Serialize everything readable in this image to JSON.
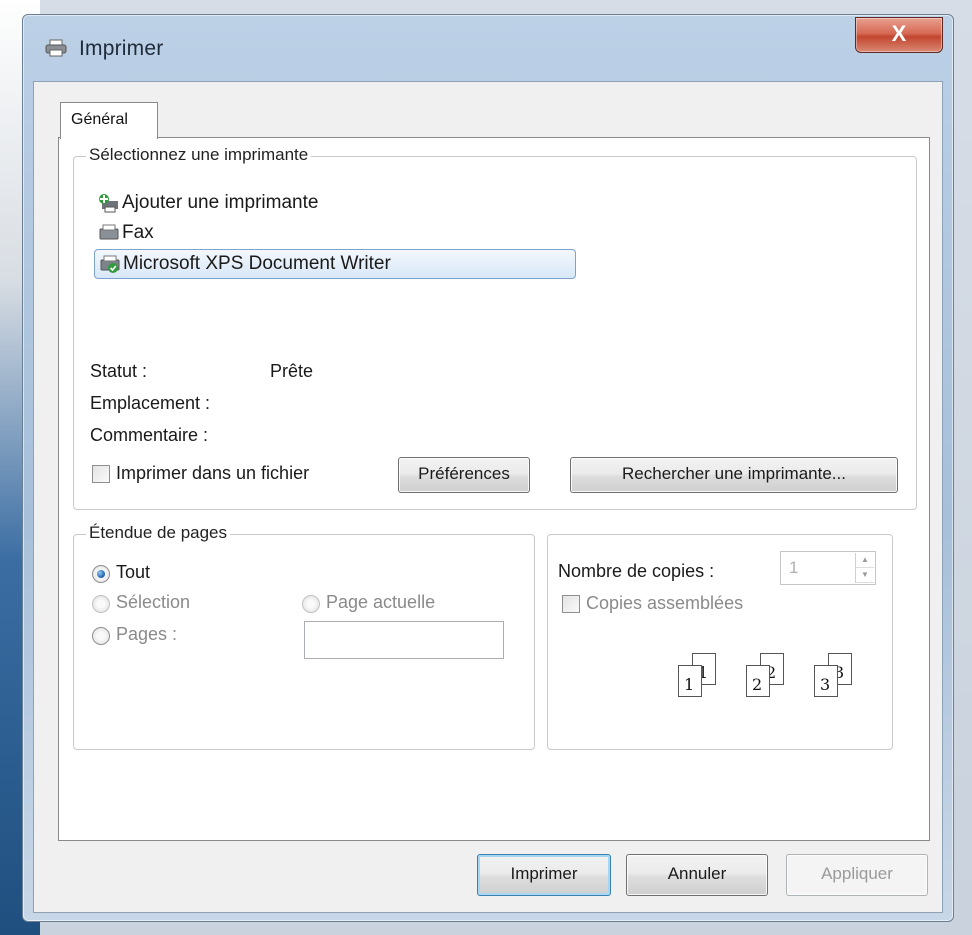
{
  "window": {
    "title": "Imprimer",
    "close_label": "X"
  },
  "tabs": [
    "Général"
  ],
  "printer_group": {
    "label": "Sélectionnez une imprimante",
    "printers": [
      {
        "name": "Ajouter une imprimante",
        "icon": "add-printer-icon",
        "selected": false
      },
      {
        "name": "Fax",
        "icon": "fax-icon",
        "selected": false
      },
      {
        "name": "Microsoft XPS Document Writer",
        "icon": "xps-printer-icon",
        "selected": true
      }
    ],
    "status_label": "Statut :",
    "status_value": "Prête",
    "location_label": "Emplacement :",
    "comment_label": "Commentaire :",
    "print_to_file_label": "Imprimer dans un fichier",
    "print_to_file_checked": false,
    "preferences_button": "Préférences",
    "find_printer_button": "Rechercher une imprimante..."
  },
  "page_range": {
    "label": "Étendue de pages",
    "all_label": "Tout",
    "all_checked": true,
    "selection_label": "Sélection",
    "current_page_label": "Page actuelle",
    "pages_label": "Pages :",
    "pages_value": ""
  },
  "copies": {
    "label": "Nombre de copies :",
    "value": "1",
    "collate_label": "Copies assemblées",
    "collate_checked": false,
    "collate_pages": [
      "1",
      "1",
      "2",
      "2",
      "3",
      "3"
    ]
  },
  "buttons": {
    "print": "Imprimer",
    "cancel": "Annuler",
    "apply": "Appliquer"
  },
  "colors": {
    "selected_border": "#7da2ce",
    "close_button": "#c2462f",
    "title_bar": "#a7bfd9"
  }
}
